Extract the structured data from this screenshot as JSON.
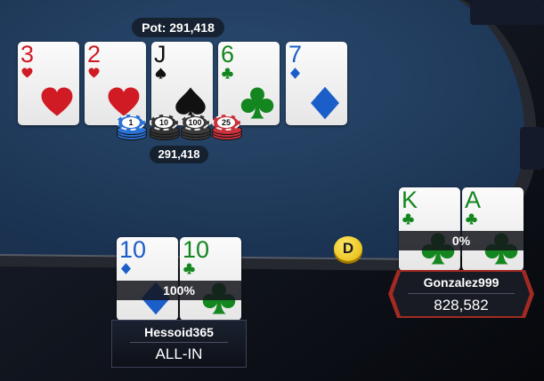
{
  "pot": {
    "label": "Pot: 291,418",
    "bet_amount": "291,418"
  },
  "board": [
    {
      "rank": "3",
      "suit": "hearts",
      "color": "red"
    },
    {
      "rank": "2",
      "suit": "hearts",
      "color": "red"
    },
    {
      "rank": "J",
      "suit": "spades",
      "color": "black"
    },
    {
      "rank": "6",
      "suit": "clubs",
      "color": "green"
    },
    {
      "rank": "7",
      "suit": "diamonds",
      "color": "blue"
    }
  ],
  "chips": [
    {
      "value": "1",
      "color": "#2a72d6"
    },
    {
      "value": "10",
      "color": "#333333"
    },
    {
      "value": "100",
      "color": "#3a3a3a"
    },
    {
      "value": "25",
      "color": "#c9323c"
    }
  ],
  "dealer_button": "D",
  "players": {
    "left": {
      "name": "Hessoid365",
      "status": "ALL-IN",
      "equity": "100%",
      "cards": [
        {
          "rank": "10",
          "suit": "diamonds",
          "color": "blue"
        },
        {
          "rank": "10",
          "suit": "clubs",
          "color": "green"
        }
      ]
    },
    "right": {
      "name": "Gonzalez999",
      "stack": "828,582",
      "equity": "0%",
      "cards": [
        {
          "rank": "K",
          "suit": "clubs",
          "color": "green"
        },
        {
          "rank": "A",
          "suit": "clubs",
          "color": "green"
        }
      ]
    }
  },
  "colors": {
    "felt": "#223a58",
    "rail": "#1d1f24",
    "accent_red": "#b0281f",
    "background": "#0c0f16"
  }
}
